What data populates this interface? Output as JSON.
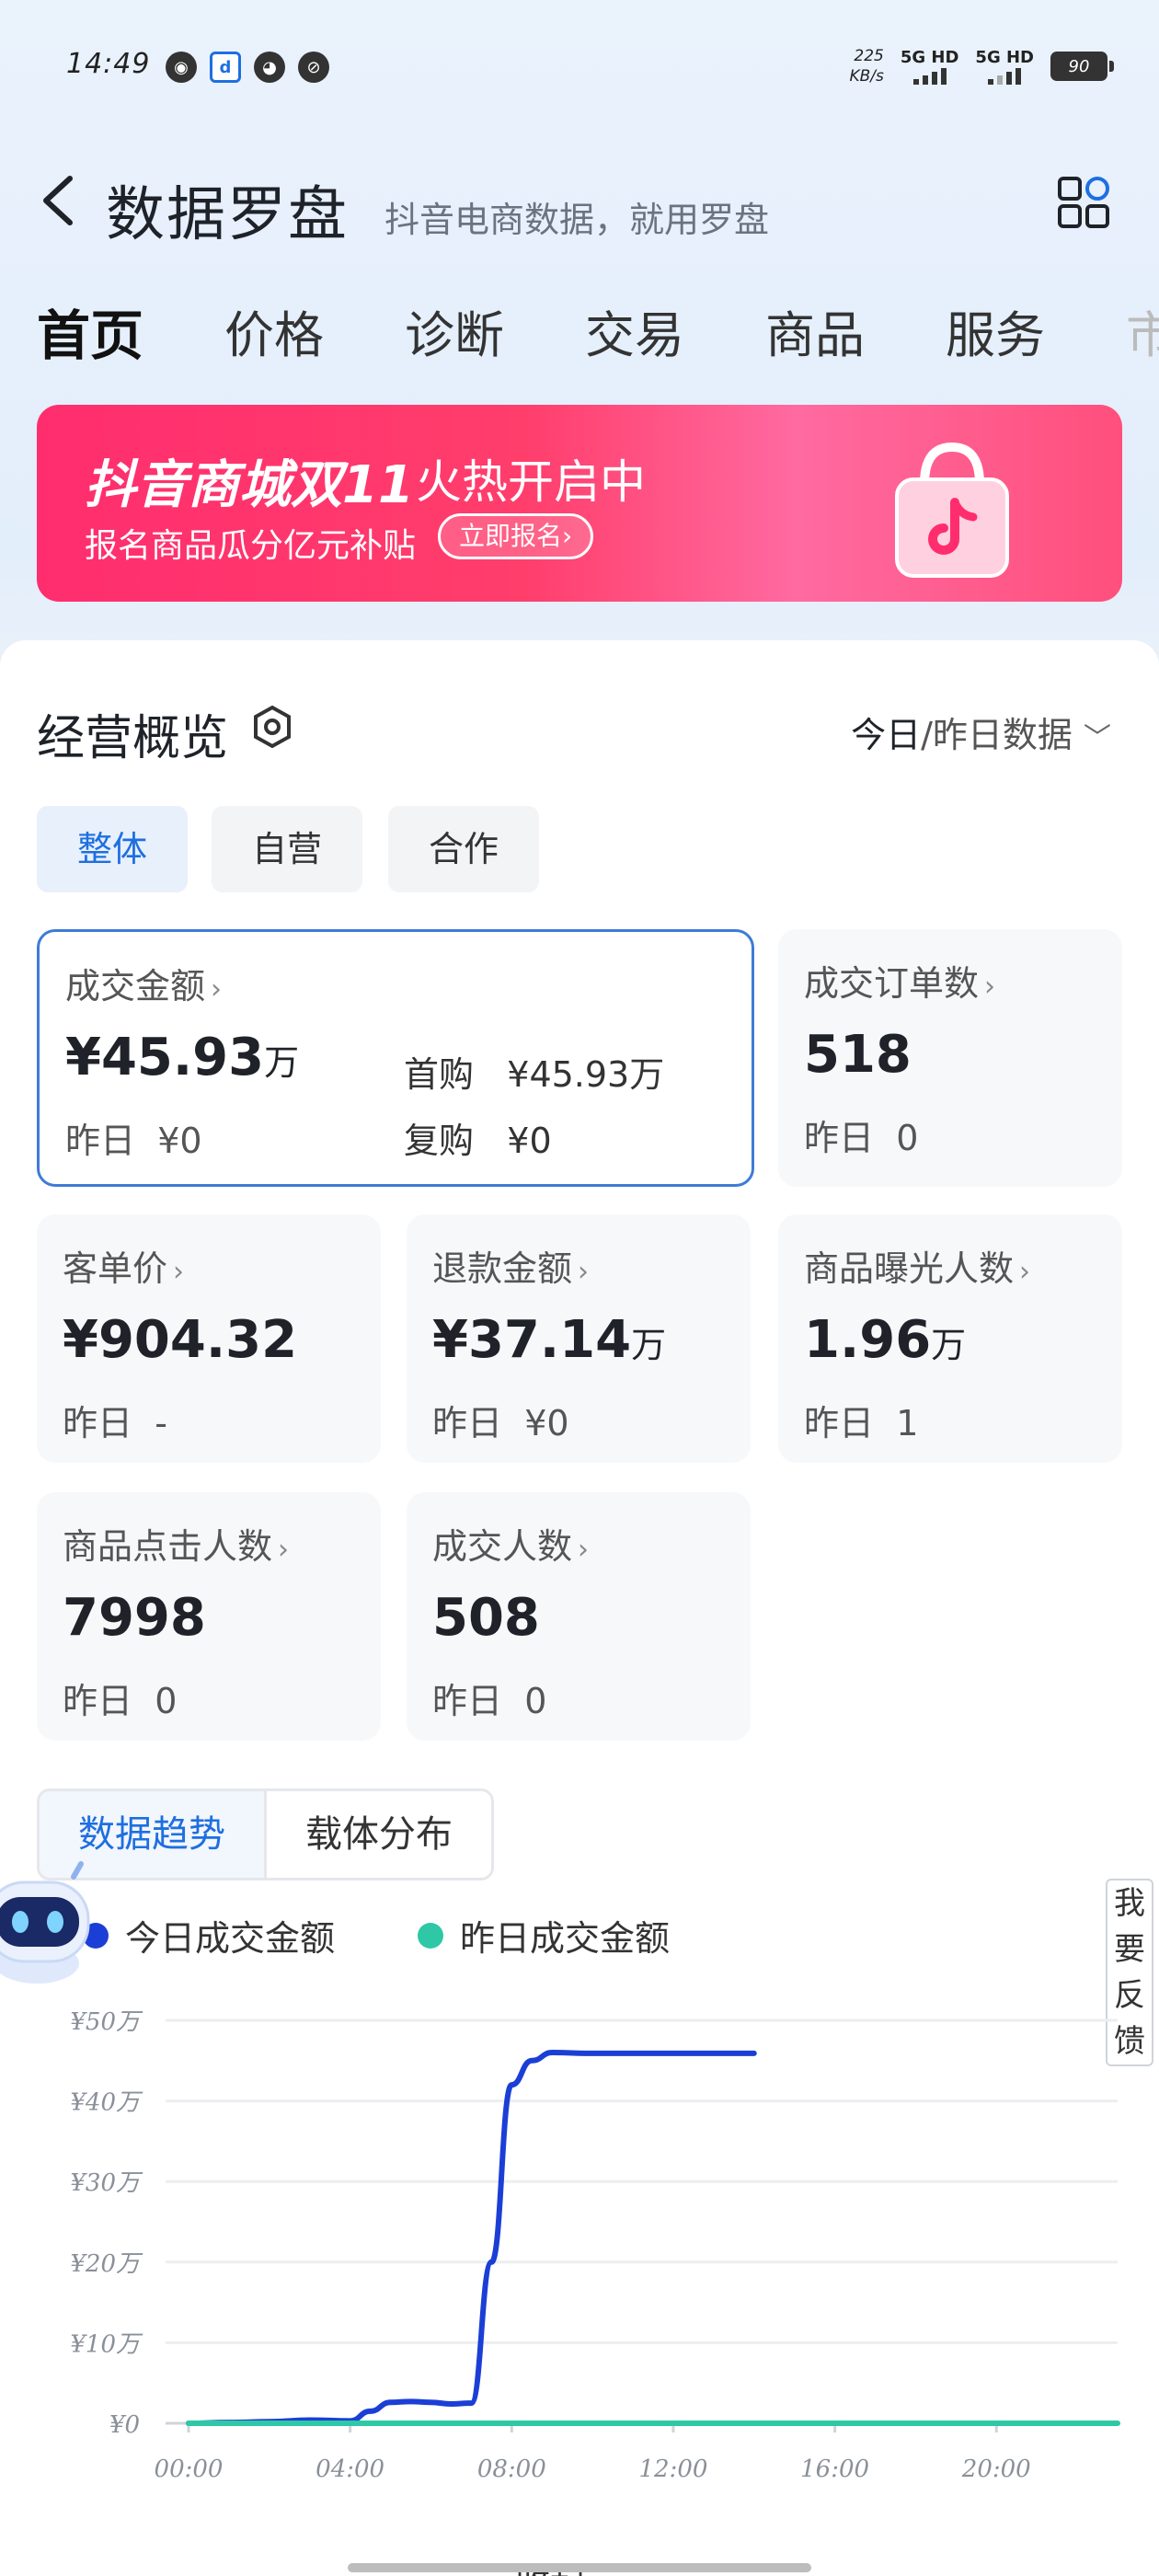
{
  "status": {
    "time": "14:49",
    "speed_value": "225",
    "speed_unit": "KB/s",
    "net1": "5G HD",
    "net2": "5G HD",
    "battery": "90"
  },
  "header": {
    "title": "数据罗盘",
    "subtitle": "抖音电商数据，就用罗盘"
  },
  "tabs": [
    {
      "label": "首页"
    },
    {
      "label": "价格"
    },
    {
      "label": "诊断"
    },
    {
      "label": "交易"
    },
    {
      "label": "商品"
    },
    {
      "label": "服务"
    },
    {
      "label": "市"
    }
  ],
  "banner": {
    "title": "抖音商城双11",
    "hot": "火热开启中",
    "sub": "报名商品瓜分亿元补贴",
    "button": "立即报名›"
  },
  "overview": {
    "title": "经营概览",
    "date_today": "今日",
    "date_rest": "/昨日数据",
    "segments": [
      "整体",
      "自营",
      "合作"
    ]
  },
  "metrics": {
    "gmv": {
      "label": "成交金额",
      "value": "¥45.93",
      "unit": "万",
      "yest_label": "昨日",
      "yest": "¥0",
      "first_label": "首购",
      "first": "¥45.93万",
      "repeat_label": "复购",
      "repeat": "¥0"
    },
    "orders": {
      "label": "成交订单数",
      "value": "518",
      "yest_label": "昨日",
      "yest": "0"
    },
    "aov": {
      "label": "客单价",
      "value": "¥904.32",
      "yest_label": "昨日",
      "yest": "-"
    },
    "refund": {
      "label": "退款金额",
      "value": "¥37.14",
      "unit": "万",
      "yest_label": "昨日",
      "yest": "¥0"
    },
    "exposure": {
      "label": "商品曝光人数",
      "value": "1.96",
      "unit": "万",
      "yest_label": "昨日",
      "yest": "1"
    },
    "clicks": {
      "label": "商品点击人数",
      "value": "7998",
      "yest_label": "昨日",
      "yest": "0"
    },
    "buyers": {
      "label": "成交人数",
      "value": "508",
      "yest_label": "昨日",
      "yest": "0"
    }
  },
  "trend": {
    "tabs": [
      "数据趋势",
      "载体分布"
    ],
    "legend_today": "今日成交金额",
    "legend_yesterday": "昨日成交金额",
    "feedback": [
      "我",
      "要",
      "反",
      "馈"
    ],
    "collapse": "收起",
    "colors": {
      "today": "#1b3fd6",
      "yesterday": "#2ec8a6"
    }
  },
  "chart_data": {
    "type": "line",
    "ylim": [
      0,
      50
    ],
    "yticks": [
      "¥0",
      "¥10万",
      "¥20万",
      "¥30万",
      "¥40万",
      "¥50万"
    ],
    "xlim": [
      0,
      23
    ],
    "xticks": [
      "00:00",
      "04:00",
      "08:00",
      "12:00",
      "16:00",
      "20:00"
    ],
    "series": [
      {
        "name": "今日成交金额",
        "color": "#1b3fd6",
        "x": [
          0,
          1,
          2,
          3,
          4,
          4.5,
          5,
          5.5,
          6,
          6.5,
          7,
          7.5,
          8,
          8.5,
          9,
          10,
          11,
          12,
          13,
          14
        ],
        "y": [
          0,
          0.1,
          0.2,
          0.4,
          0.3,
          1.5,
          2.6,
          2.7,
          2.6,
          2.4,
          2.5,
          20,
          42,
          45,
          46,
          45.9,
          45.9,
          45.9,
          45.9,
          45.9
        ]
      },
      {
        "name": "昨日成交金额",
        "color": "#2ec8a6",
        "x": [
          0,
          23
        ],
        "y": [
          0,
          0
        ]
      }
    ]
  }
}
